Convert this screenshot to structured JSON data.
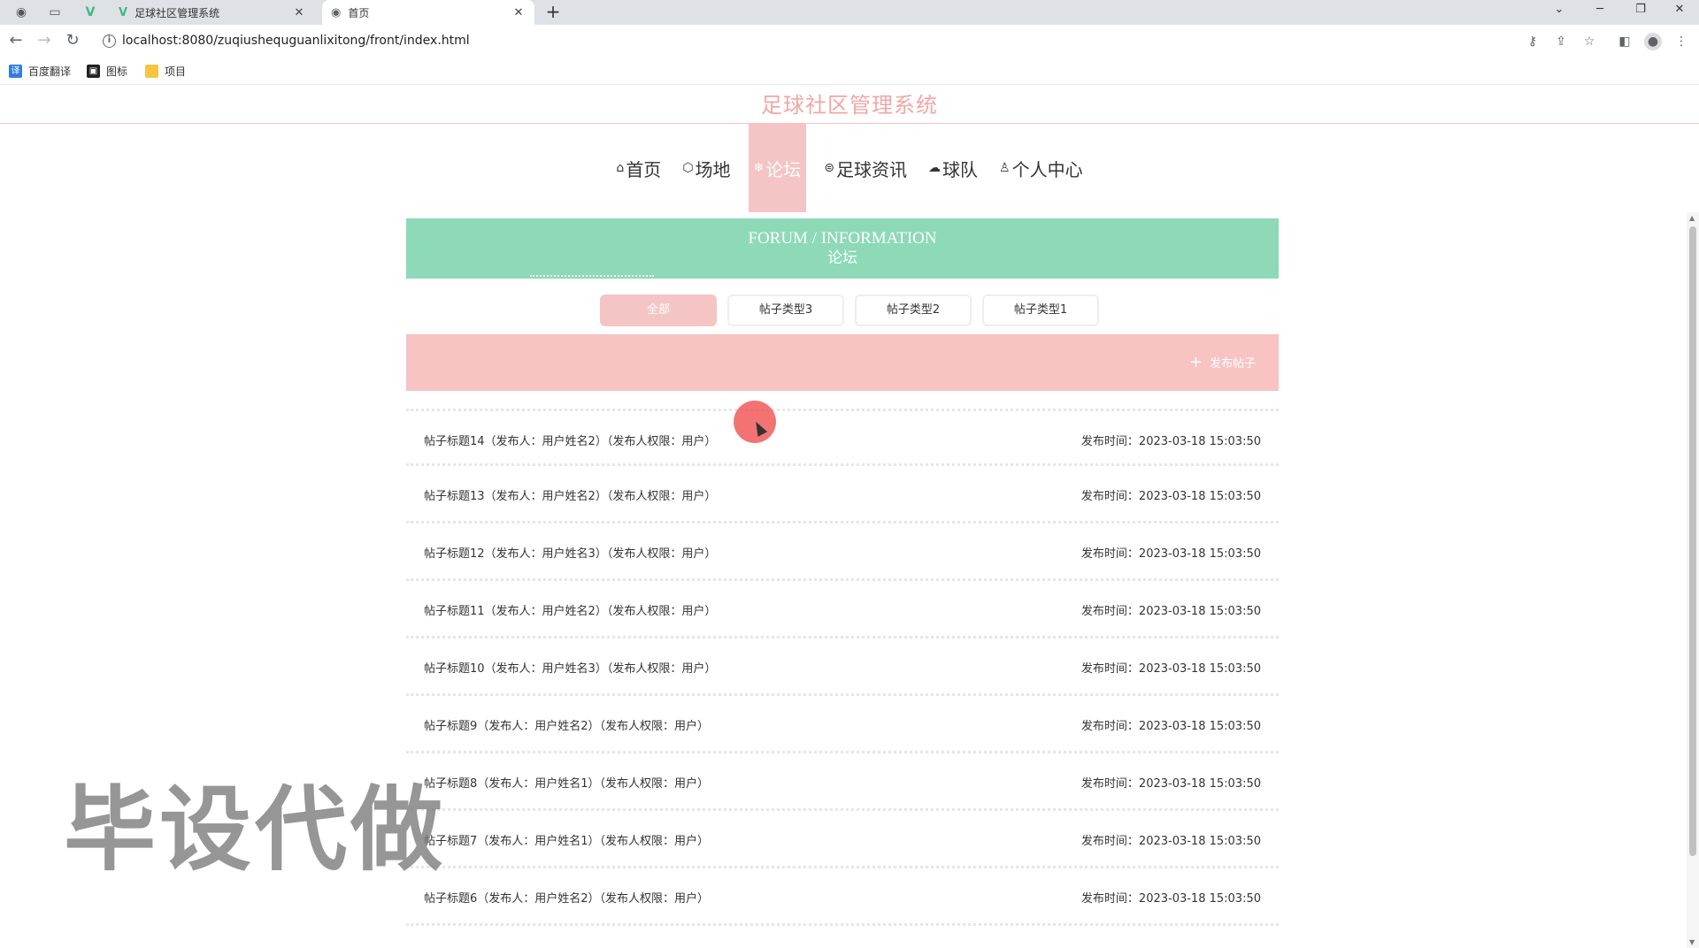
{
  "browser": {
    "tabs": [
      {
        "title": "足球社区管理系统",
        "close": "✕"
      },
      {
        "title": "首页",
        "close": "✕"
      }
    ],
    "new_tab": "+",
    "url": "localhost:8080/zuqiushequguanlixitong/front/index.html",
    "bookmarks": [
      "百度翻译",
      "图标",
      "项目"
    ]
  },
  "site": {
    "title": "足球社区管理系统",
    "nav": [
      {
        "label": "首页",
        "icon": "home-icon"
      },
      {
        "label": "场地",
        "icon": "cube-icon"
      },
      {
        "label": "论坛",
        "icon": "snowflake-icon",
        "active": true
      },
      {
        "label": "足球资讯",
        "icon": "newspaper-icon"
      },
      {
        "label": "球队",
        "icon": "cloud-icon"
      },
      {
        "label": "个人中心",
        "icon": "user-icon"
      }
    ]
  },
  "banner": {
    "en": "FORUM / INFORMATION",
    "cn": "论坛"
  },
  "filters": [
    "全部",
    "帖子类型3",
    "帖子类型2",
    "帖子类型1"
  ],
  "post_button": "发布帖子",
  "posts": [
    {
      "title": "帖子标题14（发布人：用户姓名2）（发布人权限：用户）",
      "time": "发布时间：2023-03-18 15:03:50"
    },
    {
      "title": "帖子标题13（发布人：用户姓名2）（发布人权限：用户）",
      "time": "发布时间：2023-03-18 15:03:50"
    },
    {
      "title": "帖子标题12（发布人：用户姓名3）（发布人权限：用户）",
      "time": "发布时间：2023-03-18 15:03:50"
    },
    {
      "title": "帖子标题11（发布人：用户姓名2）（发布人权限：用户）",
      "time": "发布时间：2023-03-18 15:03:50"
    },
    {
      "title": "帖子标题10（发布人：用户姓名3）（发布人权限：用户）",
      "time": "发布时间：2023-03-18 15:03:50"
    },
    {
      "title": "帖子标题9（发布人：用户姓名2）（发布人权限：用户）",
      "time": "发布时间：2023-03-18 15:03:50"
    },
    {
      "title": "帖子标题8（发布人：用户姓名1）（发布人权限：用户）",
      "time": "发布时间：2023-03-18 15:03:50"
    },
    {
      "title": "帖子标题7（发布人：用户姓名1）（发布人权限：用户）",
      "time": "发布时间：2023-03-18 15:03:50"
    },
    {
      "title": "帖子标题6（发布人：用户姓名2）（发布人权限：用户）",
      "time": "发布时间：2023-03-18 15:03:50"
    }
  ],
  "watermark": "毕设代做",
  "colors": {
    "accent_pink": "#f5c4c4",
    "banner_green": "#8dd9b8",
    "title_pink": "#f2a6a6"
  }
}
